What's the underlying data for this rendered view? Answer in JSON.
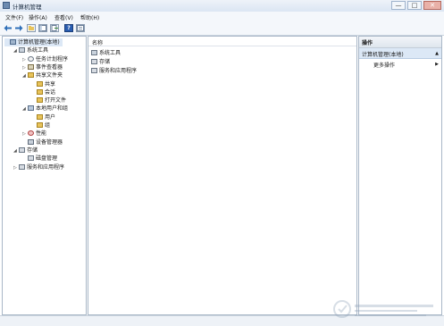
{
  "window": {
    "title": "计算机管理",
    "controls": [
      "—",
      "□",
      "✕"
    ]
  },
  "menu": [
    "文件(F)",
    "操作(A)",
    "查看(V)",
    "帮助(H)"
  ],
  "tree": [
    {
      "label": "计算机管理(本地)",
      "level": 0,
      "expander": "",
      "icon": "computer-icon"
    },
    {
      "label": "系统工具",
      "level": 1,
      "expander": "◢",
      "icon": "tools-icon"
    },
    {
      "label": "任务计划程序",
      "level": 2,
      "expander": "▷",
      "icon": "clock-icon"
    },
    {
      "label": "事件查看器",
      "level": 2,
      "expander": "▷",
      "icon": "event-viewer-icon"
    },
    {
      "label": "共享文件夹",
      "level": 2,
      "expander": "◢",
      "icon": "shared-folder-icon"
    },
    {
      "label": "共享",
      "level": 3,
      "expander": "",
      "icon": "share-icon"
    },
    {
      "label": "会话",
      "level": 3,
      "expander": "",
      "icon": "session-icon"
    },
    {
      "label": "打开文件",
      "level": 3,
      "expander": "",
      "icon": "open-file-icon"
    },
    {
      "label": "本地用户和组",
      "level": 2,
      "expander": "◢",
      "icon": "users-icon"
    },
    {
      "label": "用户",
      "level": 3,
      "expander": "",
      "icon": "folder-icon"
    },
    {
      "label": "组",
      "level": 3,
      "expander": "",
      "icon": "folder-icon"
    },
    {
      "label": "性能",
      "level": 2,
      "expander": "▷",
      "icon": "performance-icon"
    },
    {
      "label": "设备管理器",
      "level": 2,
      "expander": "",
      "icon": "device-manager-icon"
    },
    {
      "label": "存储",
      "level": 1,
      "expander": "◢",
      "icon": "storage-icon"
    },
    {
      "label": "磁盘管理",
      "level": 2,
      "expander": "",
      "icon": "disk-icon"
    },
    {
      "label": "服务和应用程序",
      "level": 1,
      "expander": "▷",
      "icon": "services-icon"
    }
  ],
  "list": {
    "header": "名称",
    "items": [
      {
        "label": "系统工具",
        "icon": "tools-icon"
      },
      {
        "label": "存储",
        "icon": "storage-icon"
      },
      {
        "label": "服务和应用程序",
        "icon": "services-icon"
      }
    ]
  },
  "actions": {
    "header": "操作",
    "section_title": "计算机管理(本地)",
    "section_arrow": "▲",
    "more_label": "更多操作",
    "more_arrow": "▶"
  },
  "colors": {
    "selection": "#dce8f6",
    "folder": "#e8c35a",
    "nav_arrow": "#2f6fb8",
    "help": "#2a5db0"
  }
}
